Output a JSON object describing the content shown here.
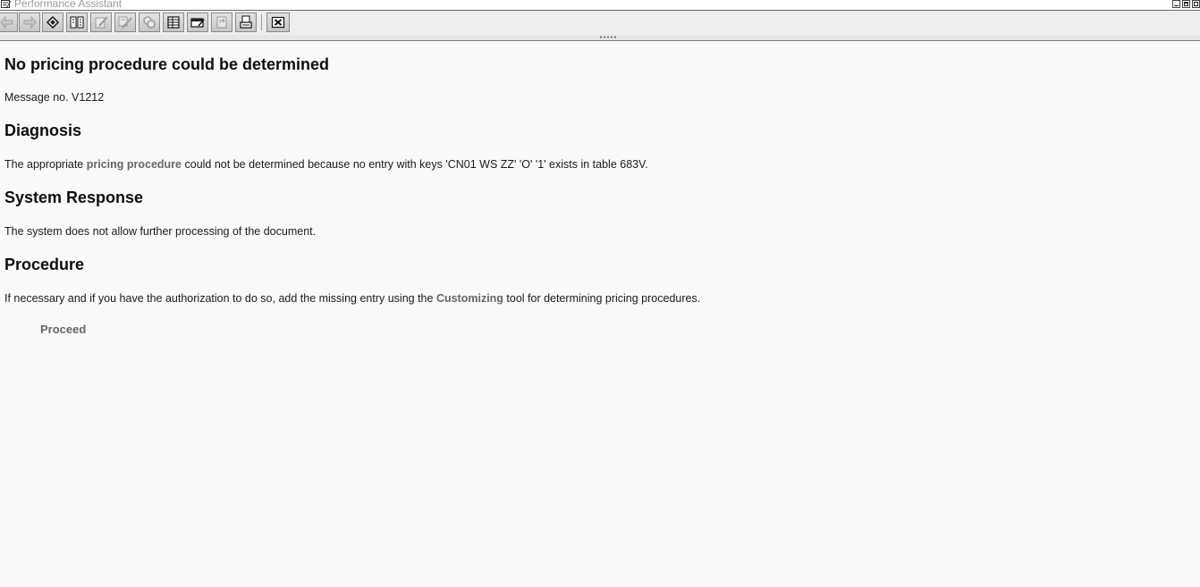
{
  "window": {
    "title": "Performance Assistant"
  },
  "toolbar": {
    "buttons": [
      {
        "icon": "back-arrow-icon",
        "enabled": false
      },
      {
        "icon": "forward-arrow-icon",
        "enabled": false
      },
      {
        "icon": "technical-info-icon",
        "enabled": true
      },
      {
        "icon": "field-info-icon",
        "enabled": true
      },
      {
        "icon": "edit-icon",
        "enabled": false
      },
      {
        "icon": "edit-extended-icon",
        "enabled": false
      },
      {
        "icon": "search-icon",
        "enabled": false
      },
      {
        "icon": "table-icon",
        "enabled": true
      },
      {
        "icon": "display-icon",
        "enabled": true
      },
      {
        "icon": "reload-icon",
        "enabled": false
      },
      {
        "icon": "print-icon",
        "enabled": true
      },
      {
        "icon": "close-icon",
        "enabled": true
      }
    ]
  },
  "doc": {
    "title": "No pricing procedure could be determined",
    "message_no": "Message no. V1212",
    "diagnosis": {
      "heading": "Diagnosis",
      "text_before": "The appropriate ",
      "link": "pricing procedure",
      "text_after": " could not be determined because no entry with keys 'CN01 WS ZZ' 'O' '1' exists in table 683V."
    },
    "system_response": {
      "heading": "System Response",
      "text": "The system does not allow further processing of the document."
    },
    "procedure": {
      "heading": "Procedure",
      "text_before": "If necessary and if you have the authorization to do so, add the missing entry using the ",
      "link": "Customizing",
      "text_after": " tool for determining pricing procedures.",
      "action": "Proceed"
    }
  }
}
